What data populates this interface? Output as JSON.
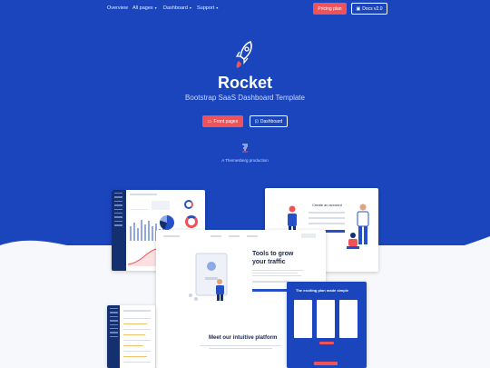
{
  "nav": {
    "items": [
      {
        "label": "Overview"
      },
      {
        "label": "All pages"
      },
      {
        "label": "Dashboard"
      },
      {
        "label": "Support"
      }
    ],
    "pricing_label": "Pricing plan",
    "docs_label": "Docs v2.0"
  },
  "hero": {
    "title": "Rocket",
    "subtitle": "Bootstrap SaaS Dashboard Template",
    "front_pages_label": "Front pages",
    "dashboard_label": "Dashboard",
    "production": "A Themesberg production"
  },
  "previews": {
    "landing_heading": "Tools to grow your traffic",
    "platform_heading": "Meet our intuitive platform",
    "login_heading": "Create an account",
    "pricing_heading": "The exciting plan made simple"
  },
  "colors": {
    "brand": "#1a45bd",
    "accent": "#f0525a"
  }
}
